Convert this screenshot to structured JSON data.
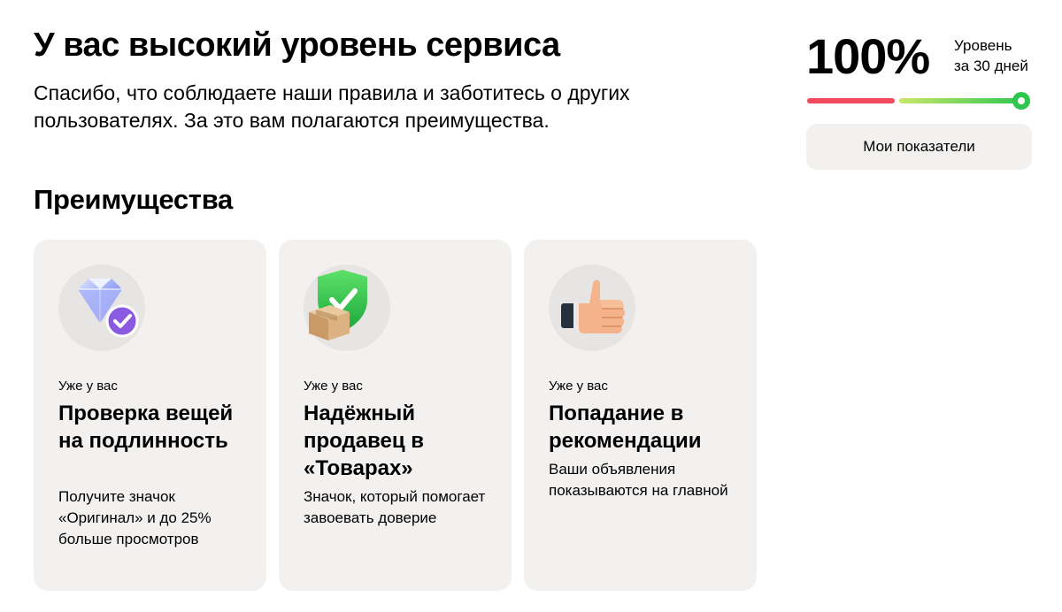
{
  "header": {
    "title": "У вас высокий уровень сервиса",
    "subtitle": "Спасибо, что соблюдаете наши правила и заботитесь о других пользователях. За это вам полагаются преимущества."
  },
  "service_level": {
    "value": "100%",
    "caption_line1": "Уровень",
    "caption_line2": "за 30 дней",
    "level_fraction": 1.0,
    "metrics_button_label": "Мои показатели",
    "colors": {
      "low": "#f24a5c",
      "high": "#2fc64e"
    }
  },
  "benefits": {
    "section_title": "Преимущества",
    "cards": [
      {
        "icon": "diamond-check-icon",
        "kicker": "Уже у вас",
        "heading": "Проверка вещей на подлинность",
        "text": "Получите значок «Оригинал» и до 25% больше просмотров"
      },
      {
        "icon": "shield-box-icon",
        "kicker": "Уже у вас",
        "heading": "Надёжный продавец в «Товарах»",
        "text": "Значок, который помогает завоевать доверие"
      },
      {
        "icon": "thumbs-up-icon",
        "kicker": "Уже у вас",
        "heading": "Попадание в рекомендации",
        "text": "Ваши объявления показываются на главной"
      }
    ]
  }
}
